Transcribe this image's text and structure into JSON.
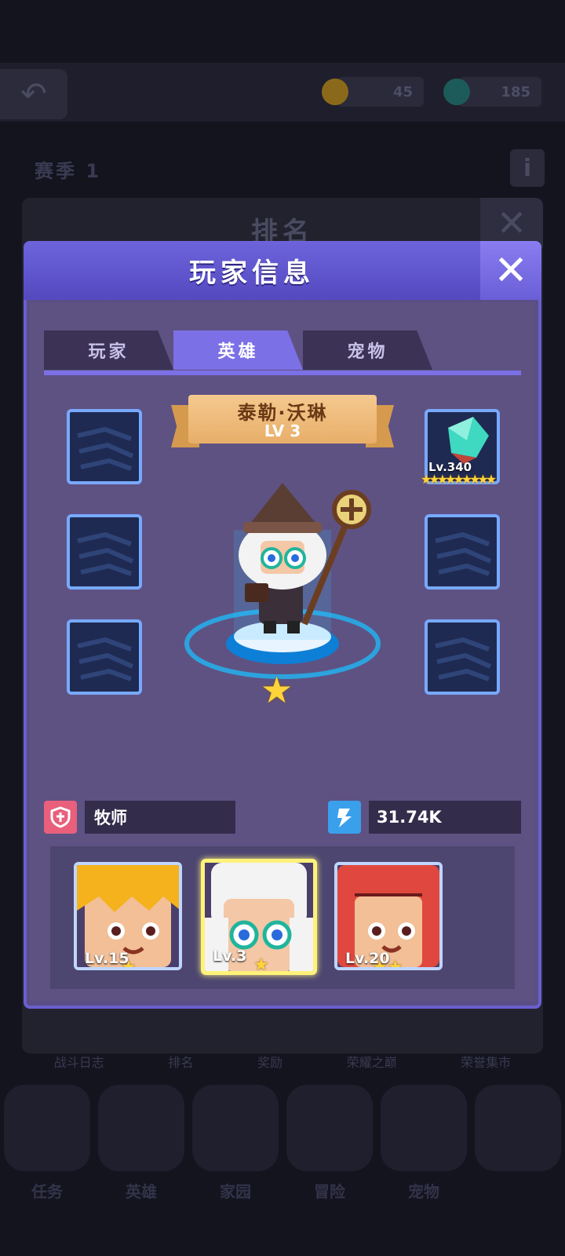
{
  "header": {
    "gold_value": "45",
    "gem_value": "185",
    "season_label": "赛季 1",
    "info_label": "i"
  },
  "ranking_panel": {
    "title": "排名",
    "bottom_tabs": [
      "战斗日志",
      "排名",
      "奖励",
      "荣耀之巅",
      "荣誉集市"
    ]
  },
  "bottom_nav": {
    "items": [
      {
        "label": "任务"
      },
      {
        "label": "英雄"
      },
      {
        "label": "家园"
      },
      {
        "label": "冒险"
      },
      {
        "label": "宠物"
      },
      {
        "label": ""
      }
    ]
  },
  "dialog": {
    "title": "玩家信息",
    "close_symbol": "✕",
    "tabs": [
      {
        "label": "玩家",
        "active": false
      },
      {
        "label": "英雄",
        "active": true
      },
      {
        "label": "宠物",
        "active": false
      }
    ],
    "hero": {
      "name": "泰勒·沃琳",
      "level": "LV 3",
      "star_count": 1
    },
    "equipped_gem": {
      "level": "Lv.340",
      "stars": "★★★★★★★★★",
      "star_count": 9,
      "color": "#3fd8c0"
    },
    "class_label": "牧师",
    "power_value": "31.74K",
    "roster": [
      {
        "level": "Lv.15",
        "stars": "★",
        "star_count": 1,
        "selected": false,
        "hair_color": "#f5b21c"
      },
      {
        "level": "Lv.3",
        "stars": "★",
        "star_count": 1,
        "selected": true,
        "hair_color": "#f3f3f3"
      },
      {
        "level": "Lv.20",
        "stars": "★★",
        "star_count": 2,
        "selected": false,
        "hair_color": "#e0483f"
      }
    ]
  },
  "colors": {
    "accent": "#7b70e6",
    "gold_star": "#ffd43b",
    "slot_border": "#78a9ff",
    "class_icon_bg": "#e8607c",
    "power_icon_bg": "#3aa0ec"
  }
}
